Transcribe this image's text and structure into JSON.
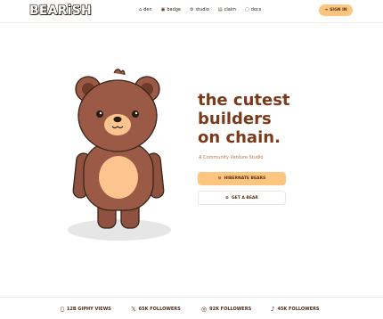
{
  "brand": {
    "logo": "BEARiSH"
  },
  "nav": {
    "links": [
      {
        "icon": "⌂",
        "label": "den"
      },
      {
        "icon": "▣",
        "label": "badge"
      },
      {
        "icon": "⚙",
        "label": "studio"
      },
      {
        "icon": "▤",
        "label": "claim"
      },
      {
        "icon": "▢",
        "label": "docs"
      }
    ],
    "signin": {
      "icon": "➔",
      "label": "SIGN IN"
    }
  },
  "hero": {
    "headline_1": "the cutest",
    "headline_2": "builders",
    "headline_3": "on chain.",
    "subtitle": "A Community Venture Studio",
    "primary_button": {
      "icon": "⊖",
      "label": "HIBERNATE BEARS"
    },
    "secondary_button": {
      "icon": "⊕",
      "label": "GET A BEAR"
    }
  },
  "stats": [
    {
      "icon": "▯",
      "label": "12B GIPHY VIEWS"
    },
    {
      "icon": "𝕏",
      "label": "65K FOLLOWERS"
    },
    {
      "icon": "◎",
      "label": "92K FOLLOWERS"
    },
    {
      "icon": "♪",
      "label": "45K FOLLOWERS"
    }
  ],
  "colors": {
    "accent": "#fcc580",
    "headline": "#7a3b1c",
    "bear_fur": "#9a5a45",
    "bear_belly": "#fcc590"
  }
}
